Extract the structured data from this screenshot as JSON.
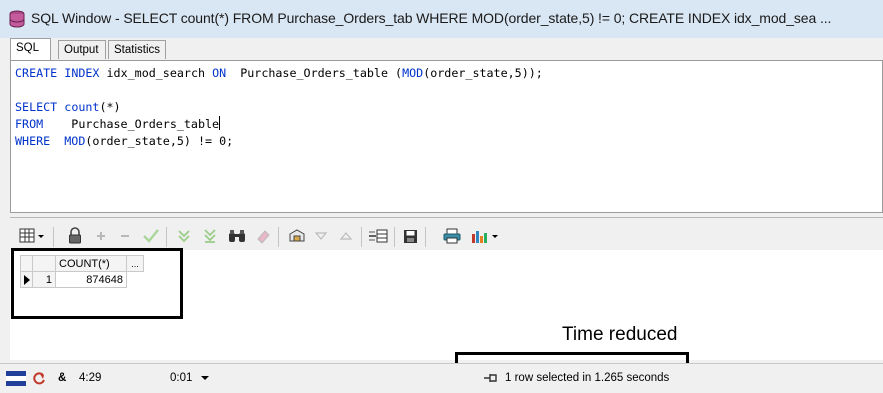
{
  "window": {
    "title": "SQL Window - SELECT count(*) FROM Purchase_Orders_tab WHERE MOD(order_state,5) != 0; CREATE INDEX idx_mod_sea ..."
  },
  "tabs": [
    {
      "label": "SQL",
      "active": true
    },
    {
      "label": "Output",
      "active": false
    },
    {
      "label": "Statistics",
      "active": false
    }
  ],
  "editor": {
    "lines": [
      "CREATE INDEX idx_mod_search ON  Purchase_Orders_table (MOD(order_state,5));",
      "",
      "SELECT count(*)",
      "FROM    Purchase_Orders_table",
      "WHERE  MOD(order_state,5) != 0;"
    ],
    "kw": {
      "create": "CREATE",
      "index": "INDEX",
      "on": "ON",
      "mod1": "MOD",
      "select": "SELECT",
      "count": "count",
      "from": "FROM",
      "where": "WHERE",
      "mod2": "MOD"
    },
    "text": {
      "l1a": " ",
      "l1b": " idx_mod_search ",
      "l1c": "  Purchase_Orders_table (",
      "l1d": "(order_state,5));",
      "l3a": " ",
      "l3b": "(*)",
      "l4a": "    Purchase_Orders_table",
      "l5a": "  ",
      "l5b": "(order_state,5) != 0;"
    }
  },
  "results": {
    "columns": [
      "COUNT(*)"
    ],
    "header_button": "...",
    "rows": [
      {
        "num": "1",
        "values": [
          "874648"
        ]
      }
    ]
  },
  "annotation": {
    "text": "Time reduced"
  },
  "statusbar": {
    "time": "4:29",
    "elapsed": "0:01",
    "message": "1 row selected in 1.265 seconds"
  },
  "icons": {
    "grid": "grid-icon",
    "lock": "lock-icon",
    "add": "plus-icon",
    "remove": "minus-icon",
    "post": "check-icon",
    "query_first": "double-chevron-down-icon",
    "query_last": "double-chevron-down-bar-icon",
    "find": "binoculars-icon",
    "clear": "eraser-icon",
    "export": "export-icon",
    "next": "triangle-down-icon",
    "prev": "triangle-up-icon",
    "single_record": "single-record-icon",
    "save": "save-icon",
    "print": "print-icon",
    "chart": "chart-icon"
  }
}
